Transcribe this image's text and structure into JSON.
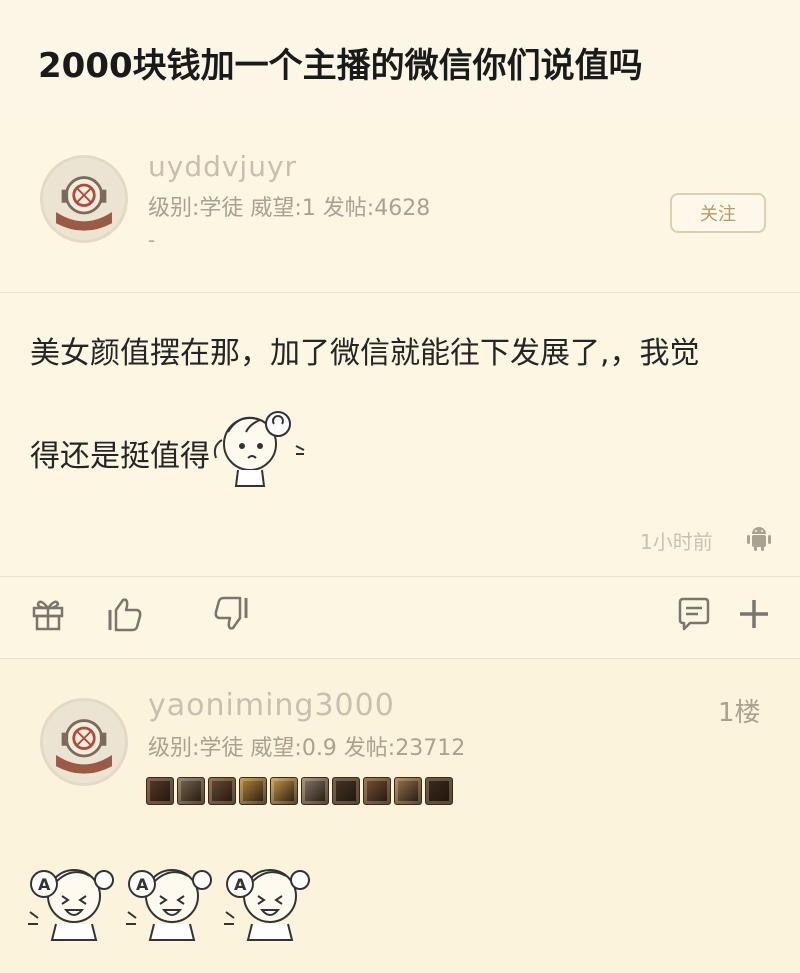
{
  "page": {
    "title": "2000块钱加一个主播的微信你们说值吗"
  },
  "post": {
    "username": "uyddvjuyr",
    "stats": "级别:学徒 威望:1 发帖:4628",
    "dash": "-",
    "follow_label": "关注",
    "content_line1": "美女颜值摆在那，加了微信就能往下发展了,，我觉",
    "content_line2": "得还是挺值得",
    "time": "1小时前",
    "actions": [
      "gift-icon",
      "like-icon",
      "dislike-icon",
      "comment-icon",
      "plus-icon"
    ]
  },
  "reply": {
    "username": "yaoniming3000",
    "stats": "级别:学徒 威望:0.9 发帖:23712",
    "floor": "1楼",
    "badge_colors": [
      "#5a3b2a",
      "#7a6a55",
      "#6b4e38",
      "#b98a3a",
      "#c89a4a",
      "#8a7a68",
      "#4a3626",
      "#7a5436",
      "#9a7650",
      "#3e2c1e"
    ],
    "emoji_count": 3
  }
}
